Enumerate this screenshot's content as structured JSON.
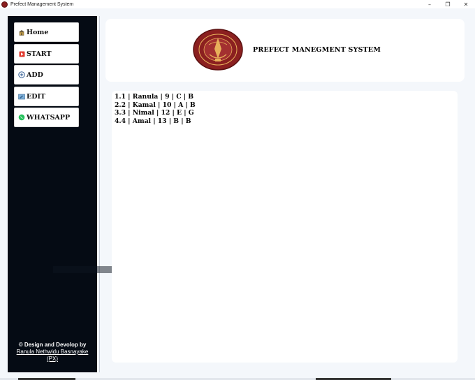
{
  "window": {
    "title": "Prefect Management System",
    "controls": {
      "minimize": "–",
      "maximize": "❐",
      "close": "✕"
    }
  },
  "sidebar": {
    "items": [
      {
        "label": "Home",
        "icon": "home-icon"
      },
      {
        "label": "START",
        "icon": "start-icon"
      },
      {
        "label": "ADD",
        "icon": "add-icon"
      },
      {
        "label": "EDIT",
        "icon": "edit-icon"
      },
      {
        "label": "WHATSAPP",
        "icon": "whatsapp-icon"
      }
    ],
    "credit": {
      "line1": "© Design and Devolop by",
      "line2": "Ranula Nethwidu Basnayake",
      "line3": "(PX)"
    }
  },
  "header": {
    "title": "PREFECT MANEGMENT SYSTEM"
  },
  "records": [
    "1.1 | Ranula | 9 | C | B",
    "2.2 | Kamal | 10 | A | B",
    "3.3 | Nimal | 12 | E | G",
    "4.4 | Amal | 13 | B | B"
  ],
  "colors": {
    "sidebar": "#050b14",
    "background": "#f4f7fb",
    "logo": "#8b2020"
  }
}
